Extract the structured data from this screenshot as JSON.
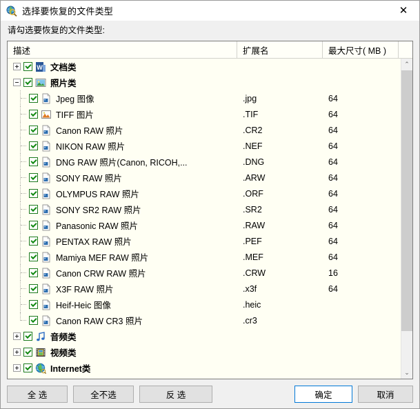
{
  "window": {
    "title": "选择要恢复的文件类型",
    "icon": "globe-search-icon",
    "close_label": "✕"
  },
  "prompt": "请勾选要恢复的文件类型:",
  "columns": {
    "description": "描述",
    "extension": "扩展名",
    "max_size": "最大尺寸( MB )"
  },
  "scrollbar": {
    "up_arrow": "⌃",
    "down_arrow": "⌄"
  },
  "rows": [
    {
      "level": "category",
      "expander": "plus",
      "checked": true,
      "icon": "word-document-icon",
      "label": "文档类",
      "ext": "",
      "size": ""
    },
    {
      "level": "category",
      "expander": "minus",
      "checked": true,
      "icon": "picture-icon",
      "label": "照片类",
      "ext": "",
      "size": ""
    },
    {
      "level": "child",
      "checked": true,
      "icon": "file-image-icon",
      "label": "Jpeg 图像",
      "ext": ".jpg",
      "size": "64"
    },
    {
      "level": "child",
      "checked": true,
      "icon": "tiff-image-icon",
      "label": "TIFF 图片",
      "ext": ".TIF",
      "size": "64"
    },
    {
      "level": "child",
      "checked": true,
      "icon": "file-image-icon",
      "label": "Canon RAW 照片",
      "ext": ".CR2",
      "size": "64"
    },
    {
      "level": "child",
      "checked": true,
      "icon": "file-image-icon",
      "label": "NIKON RAW 照片",
      "ext": ".NEF",
      "size": "64"
    },
    {
      "level": "child",
      "checked": true,
      "icon": "file-image-icon",
      "label": "DNG RAW 照片(Canon, RICOH,...",
      "ext": ".DNG",
      "size": "64"
    },
    {
      "level": "child",
      "checked": true,
      "icon": "file-image-icon",
      "label": "SONY RAW 照片",
      "ext": ".ARW",
      "size": "64"
    },
    {
      "level": "child",
      "checked": true,
      "icon": "file-image-icon",
      "label": "OLYMPUS RAW 照片",
      "ext": ".ORF",
      "size": "64"
    },
    {
      "level": "child",
      "checked": true,
      "icon": "file-image-icon",
      "label": "SONY SR2 RAW 照片",
      "ext": ".SR2",
      "size": "64"
    },
    {
      "level": "child",
      "checked": true,
      "icon": "file-image-icon",
      "label": "Panasonic RAW 照片",
      "ext": ".RAW",
      "size": "64"
    },
    {
      "level": "child",
      "checked": true,
      "icon": "file-image-icon",
      "label": "PENTAX RAW 照片",
      "ext": ".PEF",
      "size": "64"
    },
    {
      "level": "child",
      "checked": true,
      "icon": "file-image-icon",
      "label": "Mamiya MEF RAW 照片",
      "ext": ".MEF",
      "size": "64"
    },
    {
      "level": "child",
      "checked": true,
      "icon": "file-image-icon",
      "label": "Canon CRW RAW 照片",
      "ext": ".CRW",
      "size": "16"
    },
    {
      "level": "child",
      "checked": true,
      "icon": "file-image-icon",
      "label": "X3F RAW 照片",
      "ext": ".x3f",
      "size": "64"
    },
    {
      "level": "child",
      "checked": true,
      "icon": "file-image-icon",
      "label": "Heif-Heic 图像",
      "ext": ".heic",
      "size": ""
    },
    {
      "level": "child",
      "checked": true,
      "icon": "file-image-icon",
      "label": "Canon RAW CR3 照片",
      "ext": ".cr3",
      "size": ""
    },
    {
      "level": "category",
      "expander": "plus",
      "checked": true,
      "icon": "music-note-icon",
      "label": "音频类",
      "ext": "",
      "size": ""
    },
    {
      "level": "category",
      "expander": "plus",
      "checked": true,
      "icon": "film-strip-icon",
      "label": "视频类",
      "ext": "",
      "size": ""
    },
    {
      "level": "category",
      "expander": "plus",
      "checked": true,
      "icon": "globe-icon",
      "label": "Internet类",
      "ext": "",
      "size": ""
    }
  ],
  "footer": {
    "select_all": "全 选",
    "select_none": "全不选",
    "invert": "反 选",
    "ok": "确定",
    "cancel": "取消"
  },
  "colors": {
    "accent": "#0078d7",
    "check_green": "#138a13",
    "list_background": "#fffff3"
  }
}
